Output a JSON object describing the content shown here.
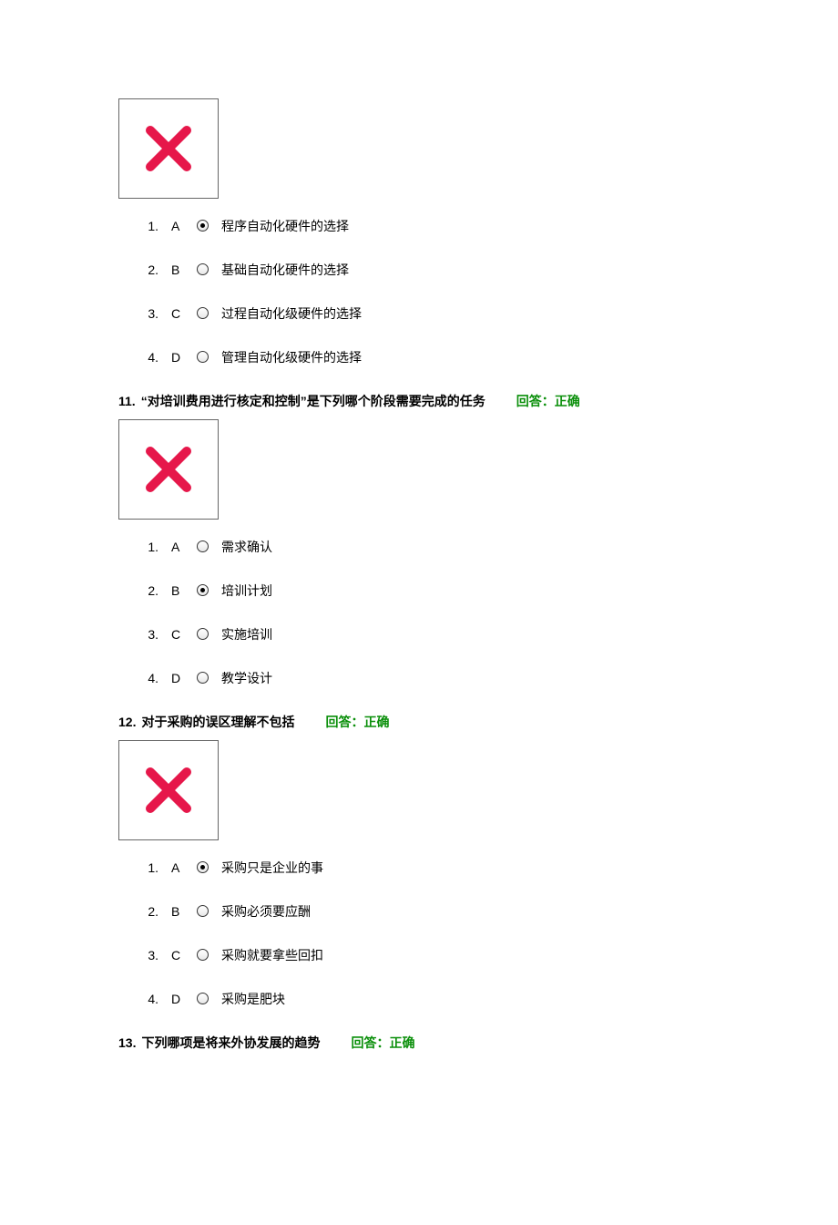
{
  "q10": {
    "options": [
      {
        "num": "1.",
        "letter": "A",
        "text": "程序自动化硬件的选择",
        "selected": true
      },
      {
        "num": "2.",
        "letter": "B",
        "text": "基础自动化硬件的选择",
        "selected": false
      },
      {
        "num": "3.",
        "letter": "C",
        "text": "过程自动化级硬件的选择",
        "selected": false
      },
      {
        "num": "4.",
        "letter": "D",
        "text": "管理自动化级硬件的选择",
        "selected": false
      }
    ]
  },
  "q11": {
    "num": "11.",
    "text": "“对培训费用进行核定和控制”是下列哪个阶段需要完成的任务",
    "answer": "回答：正确",
    "options": [
      {
        "num": "1.",
        "letter": "A",
        "text": "需求确认",
        "selected": false
      },
      {
        "num": "2.",
        "letter": "B",
        "text": "培训计划",
        "selected": true
      },
      {
        "num": "3.",
        "letter": "C",
        "text": "实施培训",
        "selected": false
      },
      {
        "num": "4.",
        "letter": "D",
        "text": "教学设计",
        "selected": false
      }
    ]
  },
  "q12": {
    "num": "12.",
    "text": "对于采购的误区理解不包括",
    "answer": "回答：正确",
    "options": [
      {
        "num": "1.",
        "letter": "A",
        "text": "采购只是企业的事",
        "selected": true
      },
      {
        "num": "2.",
        "letter": "B",
        "text": "采购必须要应酬",
        "selected": false
      },
      {
        "num": "3.",
        "letter": "C",
        "text": "采购就要拿些回扣",
        "selected": false
      },
      {
        "num": "4.",
        "letter": "D",
        "text": "采购是肥块",
        "selected": false
      }
    ]
  },
  "q13": {
    "num": "13.",
    "text": "下列哪项是将来外协发展的趋势",
    "answer": "回答：正确"
  }
}
